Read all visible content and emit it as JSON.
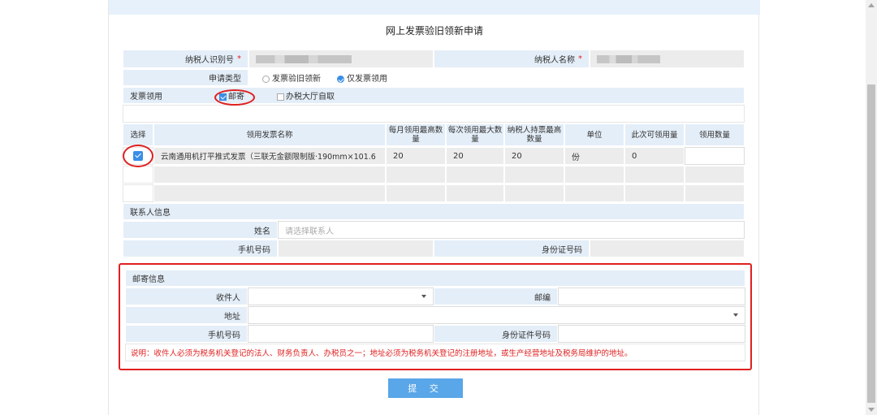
{
  "title": "网上发票验旧领新申请",
  "taxpayer": {
    "id_label": "纳税人识别号",
    "name_label": "纳税人名称",
    "required_mark": "*"
  },
  "apply_type": {
    "label": "申请类型",
    "options": [
      "发票验旧领新",
      "仅发票领用"
    ],
    "selected": "仅发票领用"
  },
  "invoice_pickup": {
    "label": "发票领用",
    "options": [
      "邮寄",
      "办税大厅自取"
    ],
    "checked": [
      "邮寄"
    ]
  },
  "invoice_table": {
    "headers": [
      "选择",
      "领用发票名称",
      "每月领用最高数量",
      "每次领用最大数量",
      "纳税人持票最高数量",
      "单位",
      "此次可领用量",
      "领用数量"
    ],
    "rows": [
      {
        "name": "云南通用机打平推式发票（三联无金额限制版·190mm×101.6",
        "monthly_max": "20",
        "per_time_max": "20",
        "holding_max": "20",
        "unit": "份",
        "available": "0",
        "quantity": ""
      }
    ]
  },
  "contact": {
    "section_label": "联系人信息",
    "name_label": "姓名",
    "name_placeholder": "请选择联系人",
    "phone_label": "手机号码",
    "id_label": "身份证号码"
  },
  "mailing": {
    "section_label": "邮寄信息",
    "recipient_label": "收件人",
    "postcode_label": "邮编",
    "address_label": "地址",
    "phone_label": "手机号码",
    "id_label": "身份证件号码",
    "note": "说明：收件人必须为税务机关登记的法人、财务负责人、办税员之一；地址必须为税务机关登记的注册地址，或生产经营地址及税务局维护的地址。"
  },
  "submit_label": "提 交",
  "colors": {
    "accent": "#3a8ee6",
    "label_bg": "#e4eef8",
    "value_bg": "#ececec",
    "highlight": "#e02020",
    "button": "#59a6e8"
  }
}
